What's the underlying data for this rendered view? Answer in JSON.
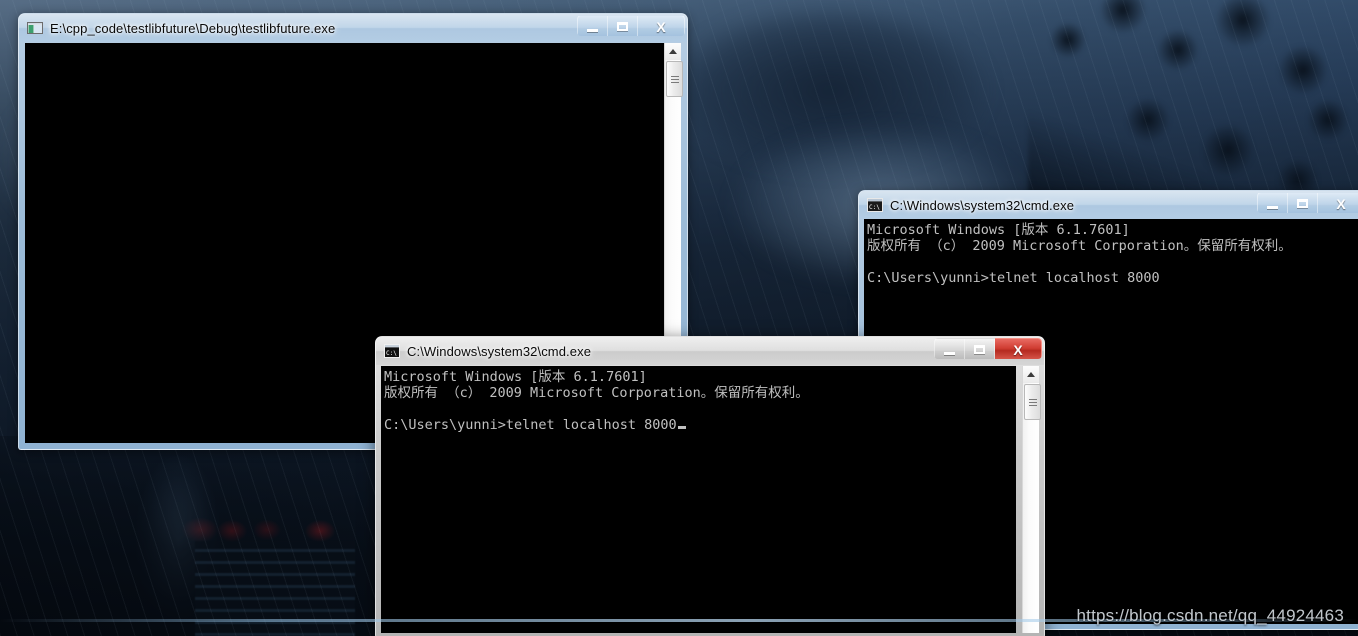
{
  "desktop": {
    "wallpaper_description": "dark rainy night scene with blue stormy sky, tree silhouettes and red lanterns",
    "watermark": "https://blog.csdn.net/qq_44924463"
  },
  "windows": [
    {
      "id": "testlibfuture",
      "title": "E:\\cpp_code\\testlibfuture\\Debug\\testlibfuture.exe",
      "icon": "vs-console-app-icon",
      "state": "inactive",
      "buttons": {
        "minimize": "–",
        "maximize": "□",
        "close": "X"
      },
      "console_lines": [],
      "scrollbar": {
        "up_arrow": "scroll-up-arrow",
        "thumb": "scroll-thumb"
      }
    },
    {
      "id": "cmd-back",
      "title": "C:\\Windows\\system32\\cmd.exe",
      "icon": "cmd-icon",
      "state": "inactive",
      "buttons": {
        "minimize": "–",
        "maximize": "□",
        "close": "X"
      },
      "console_lines": [
        "Microsoft Windows [版本 6.1.7601]",
        "版权所有 （c） 2009 Microsoft Corporation。保留所有权利。",
        "",
        "C:\\Users\\yunni>telnet localhost 8000"
      ]
    },
    {
      "id": "cmd-front",
      "title": "C:\\Windows\\system32\\cmd.exe",
      "icon": "cmd-icon",
      "state": "active",
      "buttons": {
        "minimize": "–",
        "maximize": "□",
        "close": "X"
      },
      "console_lines": [
        "Microsoft Windows [版本 6.1.7601]",
        "版权所有 （c） 2009 Microsoft Corporation。保留所有权利。",
        "",
        "C:\\Users\\yunni>telnet localhost 8000"
      ],
      "cursor": "block-cursor",
      "scrollbar": {
        "up_arrow": "scroll-up-arrow",
        "thumb": "scroll-thumb"
      }
    }
  ],
  "colors": {
    "console_bg": "#000000",
    "console_fg": "#c0c0c0",
    "active_close": "#cf3c31",
    "inactive_frame": "#9dbcd8",
    "active_frame": "#c9c9c9"
  }
}
